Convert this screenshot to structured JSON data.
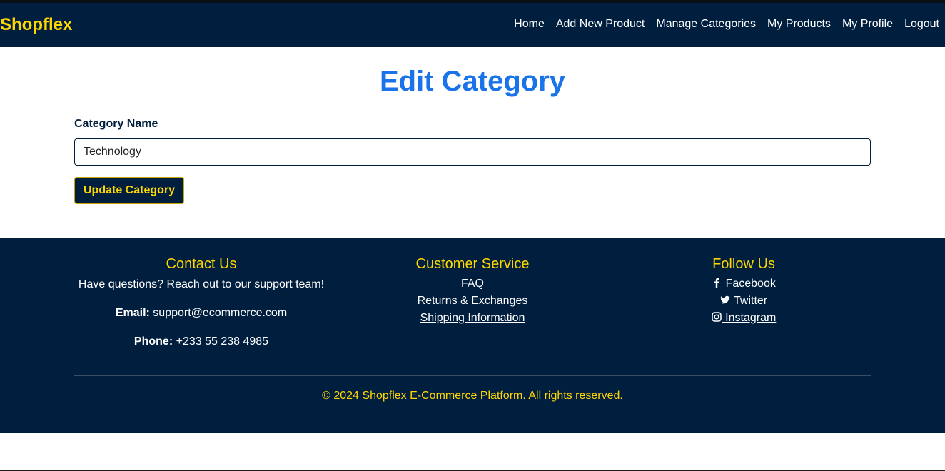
{
  "brand": "Shopflex",
  "nav": [
    {
      "label": "Home"
    },
    {
      "label": "Add New Product"
    },
    {
      "label": "Manage Categories"
    },
    {
      "label": "My Products"
    },
    {
      "label": "My Profile"
    },
    {
      "label": "Logout"
    }
  ],
  "page": {
    "title": "Edit Category"
  },
  "form": {
    "label": "Category Name",
    "value": "Technology",
    "button": "Update Category"
  },
  "footer": {
    "contact": {
      "heading": "Contact Us",
      "text": "Have questions? Reach out to our support team!",
      "email_label": "Email:",
      "email": "support@ecommerce.com",
      "phone_label": "Phone:",
      "phone": "+233 55 238 4985"
    },
    "service": {
      "heading": "Customer Service",
      "links": [
        "FAQ",
        "Returns & Exchanges",
        "Shipping Information"
      ]
    },
    "follow": {
      "heading": "Follow Us",
      "links": [
        {
          "label": " Facebook",
          "icon": "facebook-icon"
        },
        {
          "label": " Twitter",
          "icon": "twitter-icon"
        },
        {
          "label": " Instagram",
          "icon": "instagram-icon"
        }
      ]
    },
    "copyright": "© 2024 Shopflex E-Commerce Platform. All rights reserved."
  },
  "colors": {
    "navy": "#001f3f",
    "gold": "#ffd700",
    "title_blue": "#1a73e8"
  }
}
